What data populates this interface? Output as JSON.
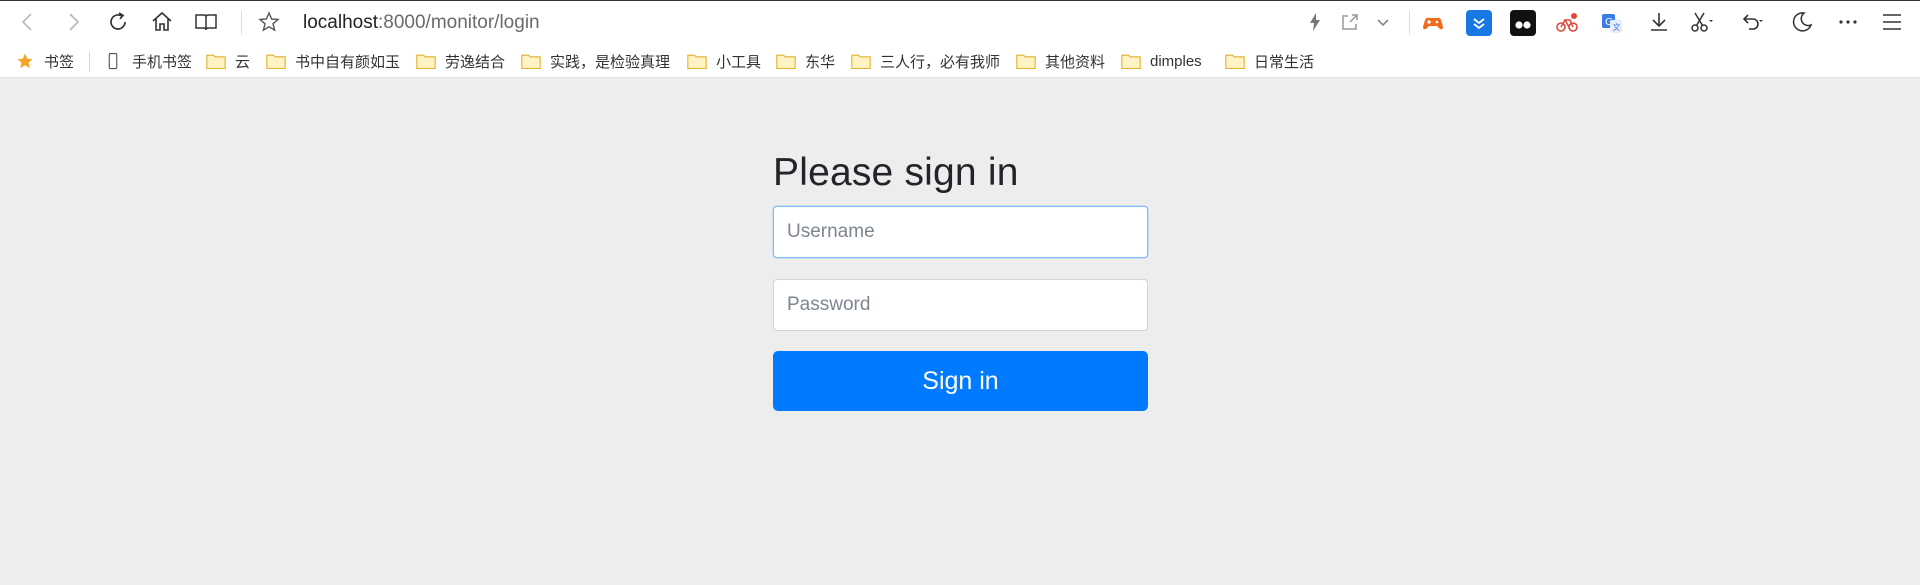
{
  "browser": {
    "address": {
      "host": "localhost",
      "path": ":8000/monitor/login"
    },
    "icons": {
      "back": "arrow-left-icon",
      "forward": "arrow-right-icon",
      "reload": "reload-icon",
      "home": "home-icon",
      "reader": "book-icon",
      "favorite": "star-icon",
      "lightning": "lightning-icon",
      "share": "share-icon",
      "dropdown": "chevron-down-icon",
      "download": "download-icon",
      "screenshot": "scissors-icon",
      "undo": "undo-icon",
      "night": "moon-icon",
      "more": "more-icon",
      "menu": "hamburger-icon"
    }
  },
  "bookmarks": [
    "书签",
    "手机书签",
    "云",
    "书中自有颜如玉",
    "劳逸结合",
    "实践，是检验真理",
    "小工具",
    "东华",
    "三人行，必有我师",
    "其他资料",
    "dimples",
    "日常生活"
  ],
  "login": {
    "title": "Please sign in",
    "username_placeholder": "Username",
    "password_placeholder": "Password",
    "submit_label": "Sign in"
  },
  "colors": {
    "primary": "#007bff",
    "background": "#ededed",
    "folder": "#f3c95a",
    "star": "#f5a623"
  }
}
